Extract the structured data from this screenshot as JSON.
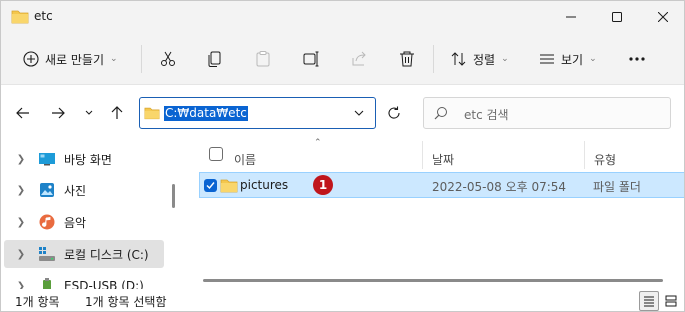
{
  "window": {
    "title": "etc"
  },
  "commandbar": {
    "new_label": "새로 만들기",
    "sort_label": "정렬",
    "view_label": "보기",
    "icons": [
      "plus-icon",
      "cut-icon",
      "copy-icon",
      "paste-icon",
      "rename-icon",
      "share-icon",
      "delete-icon",
      "sort-icon",
      "view-icon",
      "more-icon"
    ]
  },
  "address": {
    "value": "C:₩data₩etc"
  },
  "search": {
    "placeholder": "etc 검색"
  },
  "sidebar": {
    "items": [
      {
        "label": "바탕 화면",
        "icon": "desktop-icon"
      },
      {
        "label": "사진",
        "icon": "pictures-icon"
      },
      {
        "label": "음악",
        "icon": "music-icon"
      },
      {
        "label": "로컬 디스크 (C:)",
        "icon": "drive-icon",
        "selected": true
      },
      {
        "label": "ESD-USB (D:)",
        "icon": "usb-drive-icon"
      }
    ]
  },
  "columns": {
    "name": "이름",
    "date": "날짜",
    "type": "유형"
  },
  "files": [
    {
      "name": "pictures",
      "date": "2022-05-08 오후 07:54",
      "type": "파일 폴더",
      "badge": "1",
      "selected": true
    }
  ],
  "status": {
    "count": "1개 항목",
    "selection": "1개 항목 선택함"
  },
  "colors": {
    "accent": "#0a64d2",
    "selection_bg": "#cce8ff",
    "badge": "#c0161c",
    "folder": "#f4c74d"
  }
}
